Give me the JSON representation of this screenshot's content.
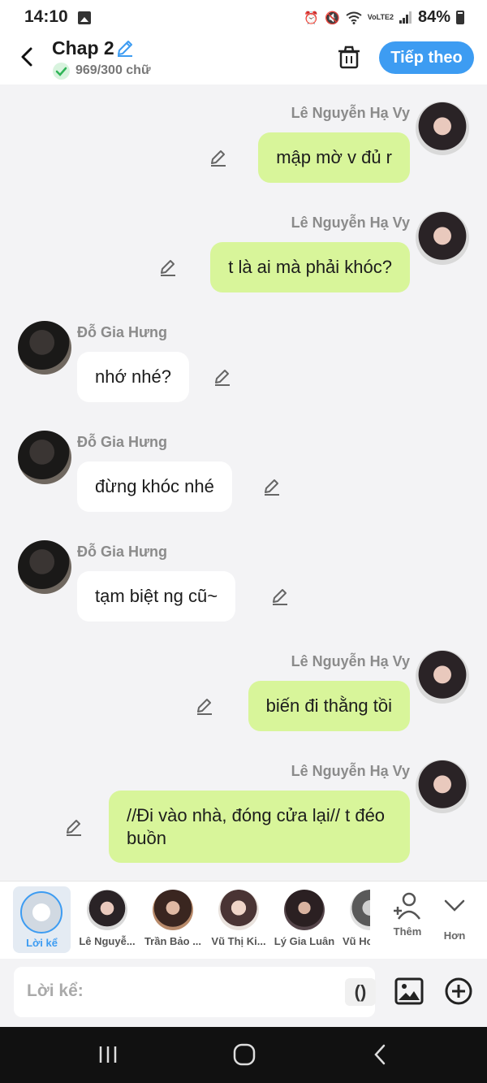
{
  "status_bar": {
    "time": "14:10",
    "network_label": "VoLTE2",
    "battery": "84%"
  },
  "header": {
    "title": "Chap 2",
    "word_count": "969/300 chữ",
    "next_label": "Tiếp theo"
  },
  "messages": [
    {
      "sender": "Lê Nguyễn Hạ Vy",
      "text": "mập mờ v đủ r"
    },
    {
      "sender": "Lê Nguyễn Hạ Vy",
      "text": "t là ai mà phải khóc?"
    },
    {
      "sender": "Đỗ Gia Hưng",
      "text": "nhớ nhé?"
    },
    {
      "sender": "Đỗ Gia Hưng",
      "text": "đừng khóc nhé"
    },
    {
      "sender": "Đỗ Gia Hưng",
      "text": "tạm biệt ng cũ~"
    },
    {
      "sender": "Lê Nguyễn Hạ Vy",
      "text": "biến đi thằng tồi"
    },
    {
      "sender": "Lê Nguyễn Hạ Vy",
      "text": "//Đi vào nhà, đóng cửa lại// t đéo buồn"
    }
  ],
  "characters": {
    "narrator_label": "Lời kể",
    "items": [
      {
        "label": "Lê Nguyễ..."
      },
      {
        "label": "Trần Bảo ..."
      },
      {
        "label": "Vũ Thị Ki..."
      },
      {
        "label": "Lý Gia Luân"
      },
      {
        "label": "Vũ Hoa"
      }
    ],
    "add_label": "Thêm",
    "less_label": "Hơn"
  },
  "composer": {
    "placeholder": "Lời kể:",
    "paren_label": "()"
  },
  "colors": {
    "accent": "#3d9cf2",
    "bubble_self": "#d8f59a",
    "bubble_other": "#ffffff",
    "background": "#f3f3f5"
  },
  "icons": [
    "back-icon",
    "edit-icon",
    "check-icon",
    "trash-icon",
    "pencil-icon",
    "person-add-icon",
    "chevron-down-icon",
    "image-icon",
    "add-circle-icon"
  ]
}
